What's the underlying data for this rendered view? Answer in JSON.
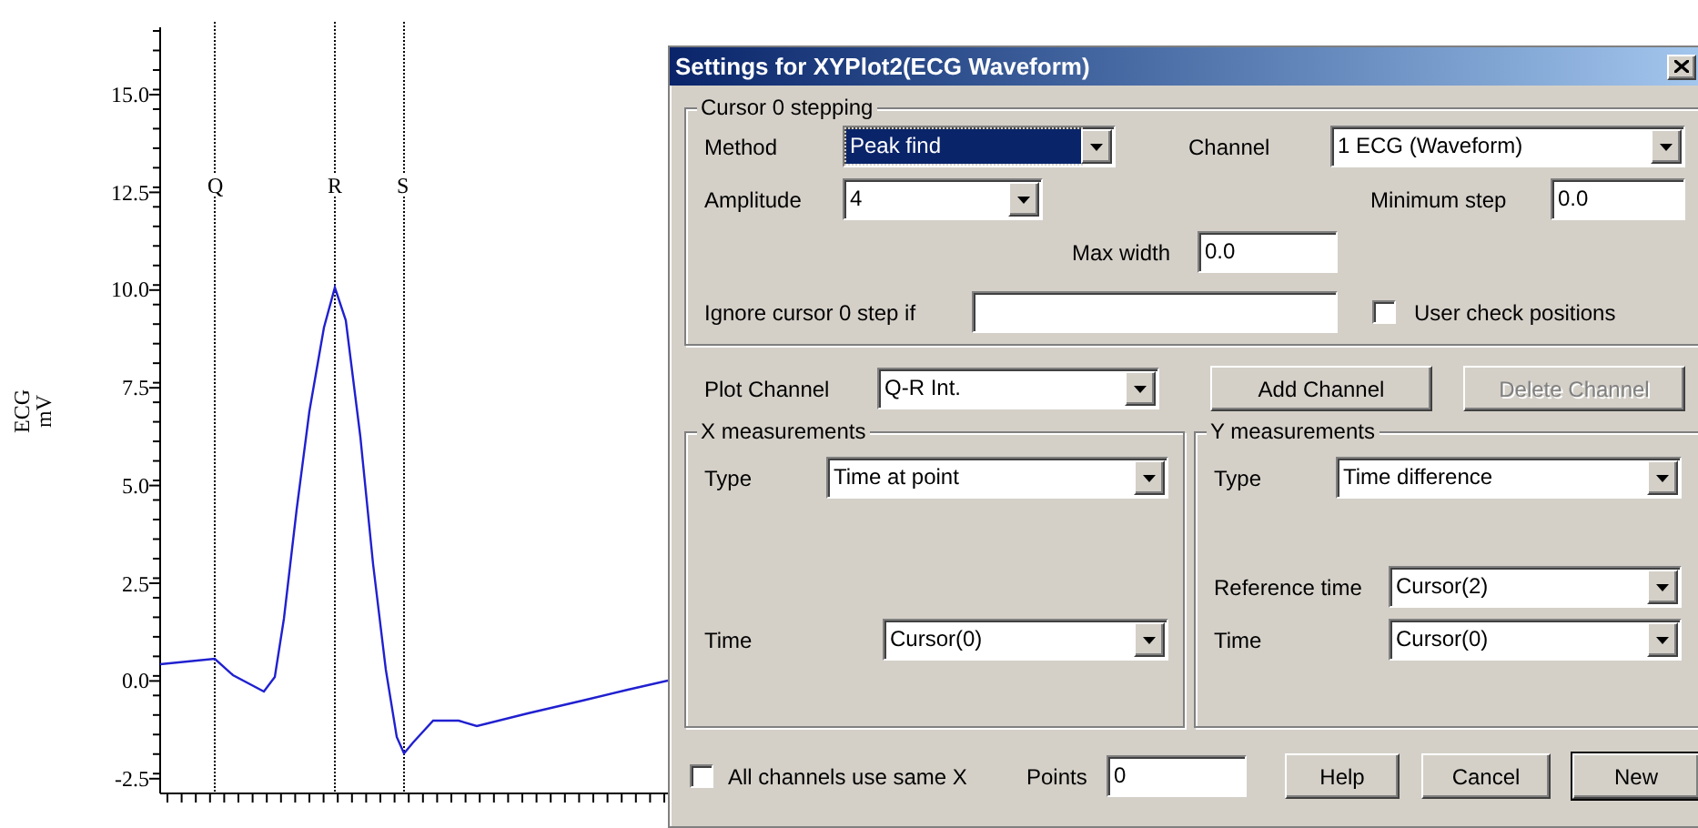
{
  "chart": {
    "y_label": "ECG",
    "y_unit": "mV",
    "y_ticks": [
      "15.0",
      "12.5",
      "10.0",
      "7.5",
      "5.0",
      "2.5",
      "0.0",
      "-2.5"
    ],
    "cursors": [
      {
        "label": "Q"
      },
      {
        "label": "R"
      },
      {
        "label": "S"
      }
    ]
  },
  "dialog": {
    "title": "Settings for XYPlot2(ECG Waveform)",
    "cursor_stepping": {
      "legend": "Cursor 0 stepping",
      "method": {
        "label": "Method",
        "value": "Peak find",
        "focused": true
      },
      "channel": {
        "label": "Channel",
        "value": "1 ECG (Waveform)",
        "focused": false
      },
      "amplitude": {
        "label": "Amplitude",
        "value": "4",
        "focused": false
      },
      "minimum_step": {
        "label": "Minimum step",
        "value": "0.0"
      },
      "max_width": {
        "label": "Max width",
        "value": "0.0"
      },
      "ignore_step_if": {
        "label": "Ignore cursor 0 step if"
      },
      "user_check_positions": {
        "label": "User check positions",
        "checked": false
      }
    },
    "plot_channel": {
      "label": "Plot Channel",
      "value": "Q-R Int.",
      "focused": false
    },
    "channel_buttons": [
      {
        "label": "Add Channel",
        "disabled": false
      },
      {
        "label": "Delete Channel",
        "disabled": true
      }
    ],
    "x_measurements": {
      "legend": "X measurements",
      "type": {
        "label": "Type",
        "value": "Time at point",
        "focused": false
      },
      "time": {
        "label": "Time",
        "value": "Cursor(0)",
        "focused": false
      }
    },
    "y_measurements": {
      "legend": "Y measurements",
      "type": {
        "label": "Type",
        "value": "Time difference",
        "focused": false
      },
      "reference_time": {
        "label": "Reference time",
        "value": "Cursor(2)",
        "focused": false
      },
      "time": {
        "label": "Time",
        "value": "Cursor(0)",
        "focused": false
      }
    },
    "all_channels_same_x": {
      "label": "All channels use same X",
      "checked": false
    },
    "points": {
      "label": "Points",
      "value": "0"
    },
    "buttons": [
      {
        "label": "Help",
        "default": false
      },
      {
        "label": "Cancel",
        "default": false
      },
      {
        "label": "New",
        "default": true
      }
    ]
  }
}
